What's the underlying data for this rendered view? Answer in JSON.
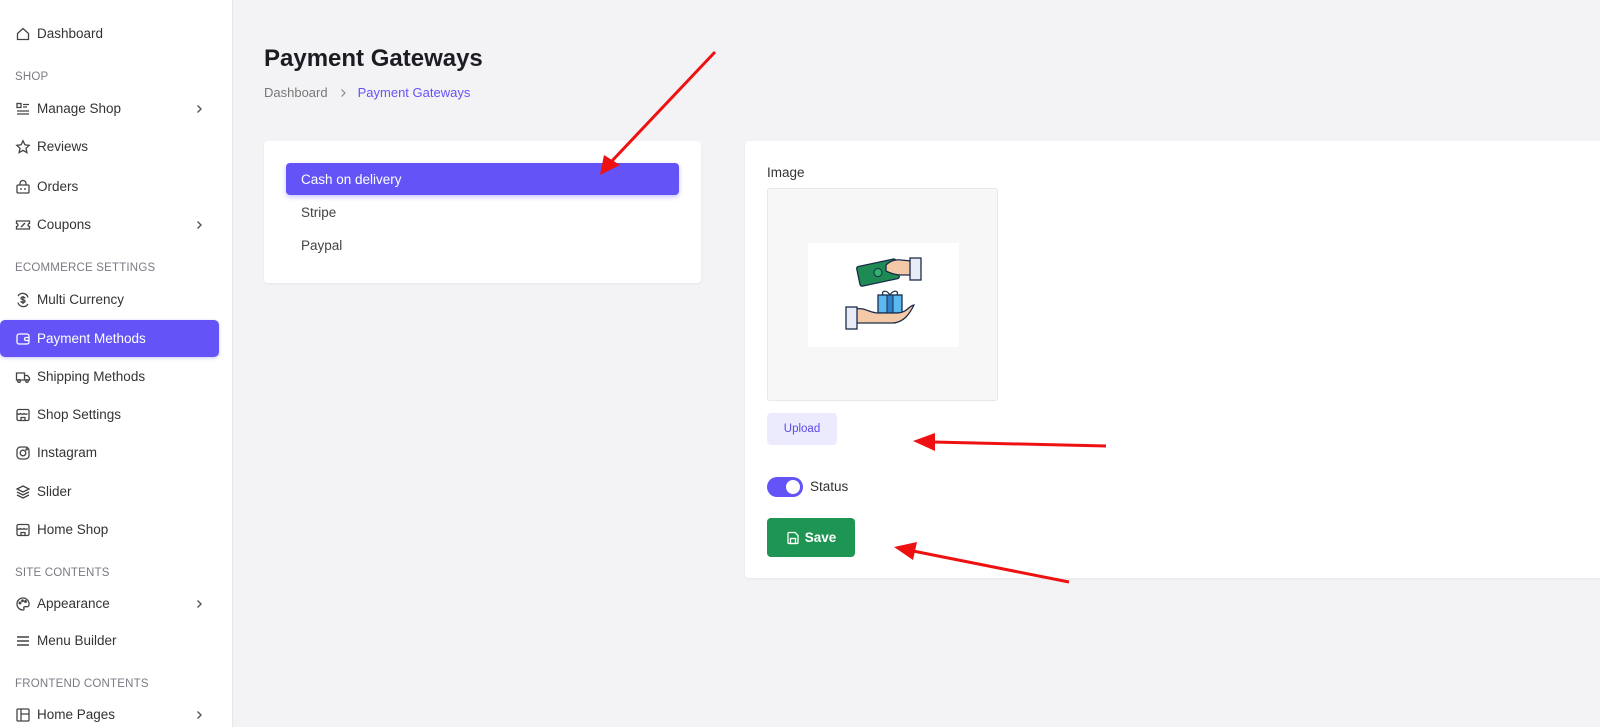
{
  "sidebar": {
    "items": [
      {
        "label": "Dashboard",
        "icon": "home-icon"
      },
      {
        "label": "Manage Shop",
        "icon": "list-icon"
      },
      {
        "label": "Reviews",
        "icon": "star-icon"
      },
      {
        "label": "Orders",
        "icon": "basket-icon"
      },
      {
        "label": "Coupons",
        "icon": "ticket-icon"
      },
      {
        "label": "Multi Currency",
        "icon": "currency-icon"
      },
      {
        "label": "Payment Methods",
        "icon": "wallet-icon"
      },
      {
        "label": "Shipping Methods",
        "icon": "truck-icon"
      },
      {
        "label": "Shop Settings",
        "icon": "store-icon"
      },
      {
        "label": "Instagram",
        "icon": "instagram-icon"
      },
      {
        "label": "Slider",
        "icon": "layers-icon"
      },
      {
        "label": "Home Shop",
        "icon": "store-icon"
      },
      {
        "label": "Appearance",
        "icon": "palette-icon"
      },
      {
        "label": "Menu Builder",
        "icon": "menu-icon"
      },
      {
        "label": "Home Pages",
        "icon": "layout-icon"
      }
    ],
    "sections": {
      "shop": "SHOP",
      "ecommerce": "ECOMMERCE SETTINGS",
      "site_contents": "SITE CONTENTS",
      "frontend_contents": "FRONTEND CONTENTS"
    }
  },
  "header": {
    "title": "Payment Gateways",
    "breadcrumb": {
      "root": "Dashboard",
      "current": "Payment Gateways"
    }
  },
  "gateways": {
    "items": [
      "Cash on delivery",
      "Stripe",
      "Paypal"
    ],
    "selected": "Cash on delivery"
  },
  "form": {
    "image_label": "Image",
    "upload_label": "Upload",
    "status_label": "Status",
    "status_enabled": true,
    "save_label": "Save"
  },
  "colors": {
    "accent": "#6453f6",
    "save": "#1f9553",
    "annotation": "#ee1111"
  }
}
